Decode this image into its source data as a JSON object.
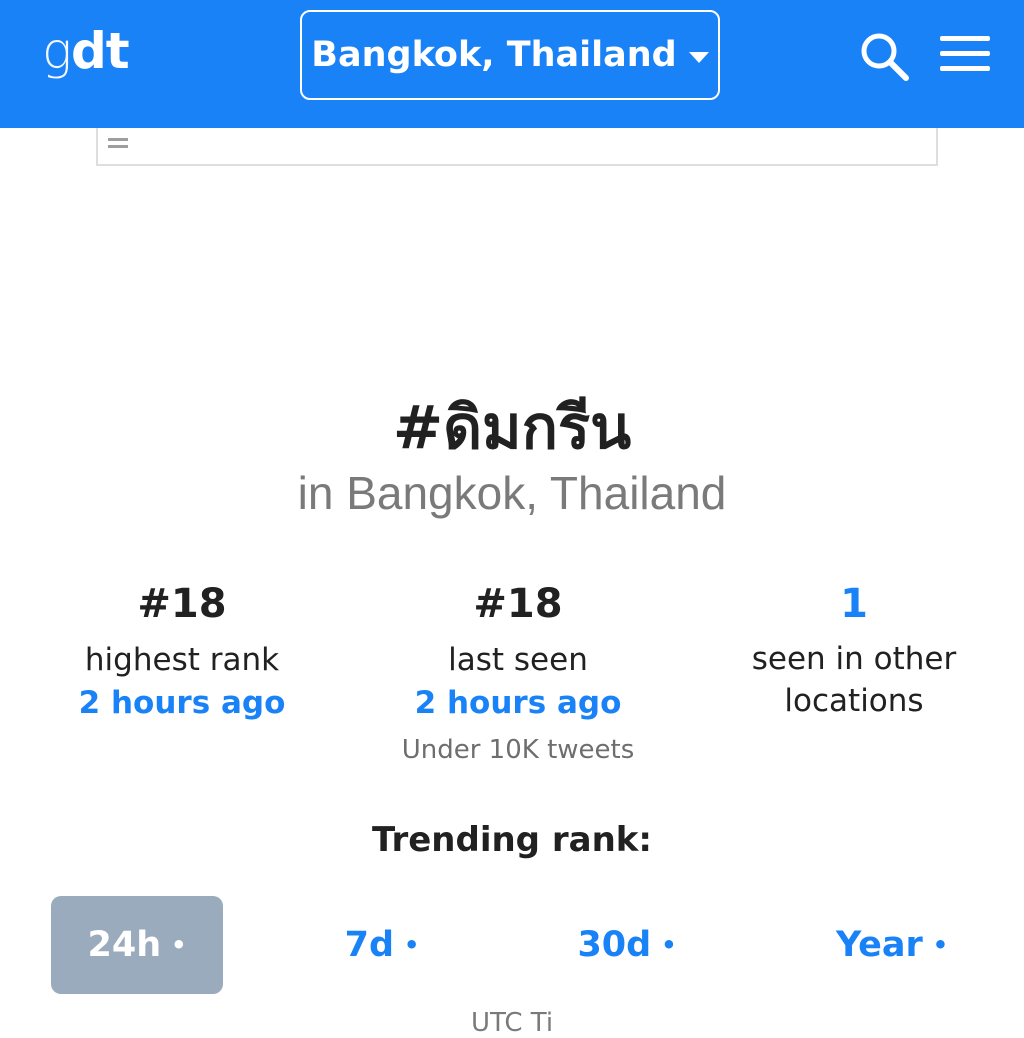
{
  "header": {
    "logo_g": "g",
    "logo_dt": "dt",
    "location": "Bangkok, Thailand"
  },
  "hashtag": {
    "title": "#ดิมกรีน",
    "subtitle": "in Bangkok, Thailand"
  },
  "stats": {
    "highest": {
      "value": "#18",
      "label": "highest rank",
      "when": "2 hours ago"
    },
    "last": {
      "value": "#18",
      "label": "last seen",
      "when": "2 hours ago",
      "note": "Under 10K tweets"
    },
    "other": {
      "value": "1",
      "label_line1": "seen in other",
      "label_line2": "locations"
    }
  },
  "trending": {
    "label": "Trending rank:",
    "periods": [
      {
        "label": "24h",
        "dot": "•",
        "active": true
      },
      {
        "label": "7d",
        "dot": "•",
        "active": false
      },
      {
        "label": "30d",
        "dot": "•",
        "active": false
      },
      {
        "label": "Year",
        "dot": "•",
        "active": false
      }
    ],
    "footer_partial": "UTC Ti"
  },
  "colors": {
    "brand_blue": "#1a82f7",
    "active_tab": "#9aabbd"
  },
  "icons": {
    "search": "search-icon",
    "menu": "hamburger-menu-icon",
    "caret": "caret-down-icon"
  }
}
